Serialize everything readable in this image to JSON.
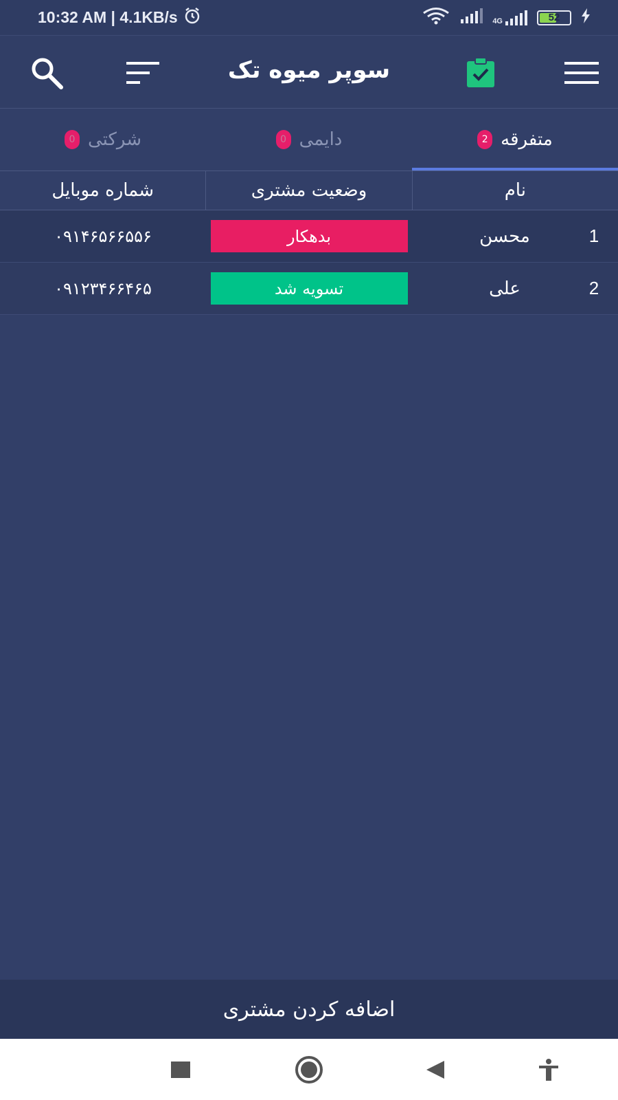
{
  "status_bar": {
    "time_speed": "10:32 AM | 4.1KB/s",
    "network": "4G",
    "battery": "52",
    "battery_color": "#8bd34f"
  },
  "app_bar": {
    "title": "سوپر میوه تک",
    "icons": [
      "hamburger-menu-icon",
      "clipboard-check-icon",
      "sort-icon",
      "search-icon"
    ],
    "accent": "#1fc47e"
  },
  "tabs": [
    {
      "label": "متفرقه",
      "count": "2"
    },
    {
      "label": "دایمی",
      "count": "0"
    },
    {
      "label": "شرکتی",
      "count": "0"
    }
  ],
  "table": {
    "headers": [
      "نام",
      "وضعیت مشتری",
      "شماره موبایل"
    ],
    "rows": [
      {
        "index": "1",
        "name": "محسن",
        "status": "بدهکار",
        "status_color": "#e81e63",
        "phone": "۰۹۱۴۶۵۶۶۵۵۶"
      },
      {
        "index": "2",
        "name": "علی",
        "status": "تسویه شد",
        "status_color": "#00c389",
        "phone": "۰۹۱۲۳۴۶۶۴۶۵"
      }
    ]
  },
  "footer": {
    "add_customer_label": "اضافه کردن مشتری"
  },
  "nav_bar": {
    "icons": [
      "recents-icon",
      "home-icon",
      "back-icon",
      "accessibility-icon"
    ]
  }
}
